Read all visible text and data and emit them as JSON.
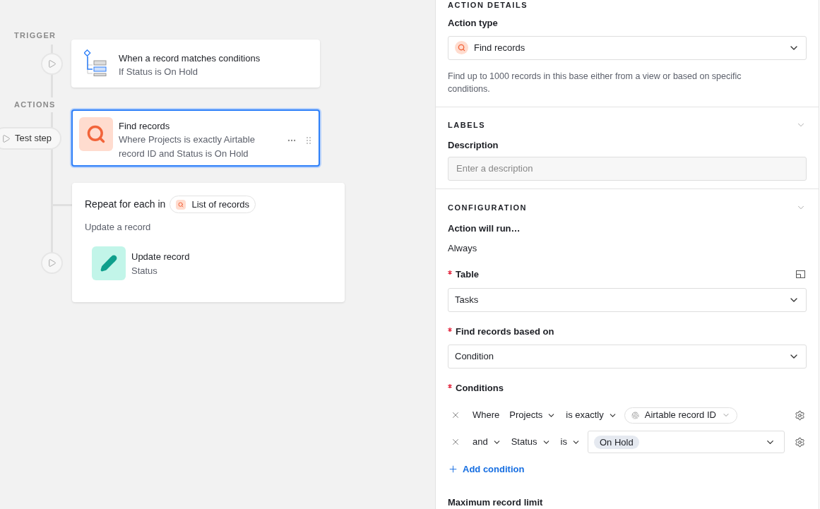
{
  "canvas": {
    "trigger_label": "TRIGGER",
    "actions_label": "ACTIONS",
    "steps": [
      {
        "kind": "trigger",
        "title": "When a record matches conditions",
        "subtitle": "If Status is On Hold",
        "selected": false
      },
      {
        "kind": "find",
        "title": "Find records",
        "subtitle": "Where Projects is exactly Airtable record ID and Status is On Hold",
        "selected": true
      }
    ],
    "test_step_button": "Test step",
    "repeat": {
      "title": "Repeat for each in",
      "source": "List of records",
      "subtitle": "Update a record",
      "step_title": "Update record",
      "step_subtitle": "Status"
    }
  },
  "panel": {
    "action_details": {
      "heading": "ACTION DETAILS",
      "action_type_label": "Action type",
      "action_type": "Find records",
      "help": "Find up to 1000 records in this base either from a view or based on specific conditions."
    },
    "labels": {
      "heading": "LABELS",
      "description_label": "Description",
      "description_placeholder": "Enter a description"
    },
    "configuration": {
      "heading": "CONFIGURATION",
      "run_label": "Action will run…",
      "run_value": "Always",
      "table": {
        "label": "Table",
        "required": true,
        "value": "Tasks"
      },
      "based_on": {
        "label": "Find records based on",
        "required": true,
        "value": "Condition"
      },
      "conditions": {
        "label": "Conditions",
        "required": true,
        "rows": [
          {
            "kind": "token",
            "conjunction": "Where",
            "conjunction_dropdown": false,
            "field": "Projects",
            "operator": "is exactly",
            "value": "Airtable record ID"
          },
          {
            "kind": "select",
            "conjunction": "and",
            "conjunction_dropdown": true,
            "field": "Status",
            "operator": "is",
            "value": "On Hold"
          }
        ]
      },
      "add_condition": "Add condition",
      "max_limit_label": "Maximum record limit"
    }
  }
}
